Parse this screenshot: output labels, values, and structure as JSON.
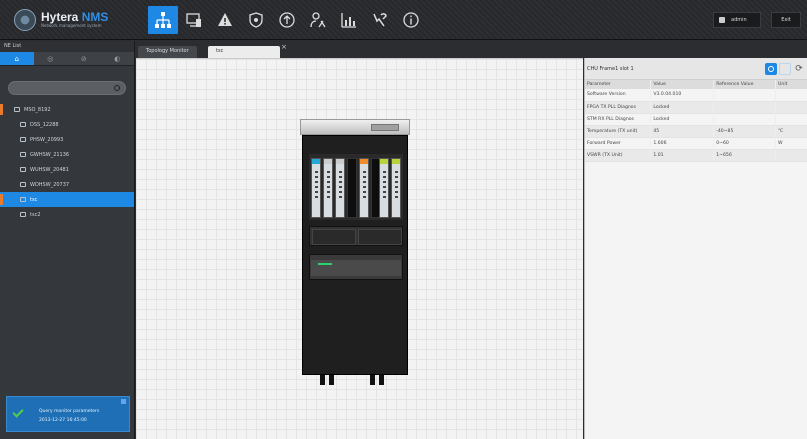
{
  "app": {
    "brand": "Hytera",
    "brand_accent": "NMS",
    "subtitle": "Network management system"
  },
  "nav": {
    "icons": [
      "topology-icon",
      "monitor-icon",
      "alarm-icon",
      "security-icon",
      "upload-icon",
      "user-config-icon",
      "statistics-icon",
      "tools-icon",
      "info-icon"
    ],
    "active": "topology-icon"
  },
  "user": {
    "name": "admin",
    "exit_label": "Exit"
  },
  "left_panel": {
    "title": "NE List",
    "tabs": [
      "⌂",
      "◎",
      "⊘",
      "◐"
    ],
    "search_placeholder": "",
    "tree": [
      {
        "label": "MSO_8192",
        "level": "root"
      },
      {
        "label": "DSS_12288",
        "level": "child"
      },
      {
        "label": "PHSW_20993",
        "level": "child"
      },
      {
        "label": "GWHSW_21136",
        "level": "child"
      },
      {
        "label": "WUHSW_20481",
        "level": "child"
      },
      {
        "label": "WDHSW_20737",
        "level": "child"
      },
      {
        "label": "tsc",
        "level": "child",
        "selected": true
      },
      {
        "label": "tsc2",
        "level": "child"
      }
    ]
  },
  "notification": {
    "title": "Query monitor parameters",
    "time": "2013-12-27 16:45:00"
  },
  "doc_tabs": [
    "Topology Monitor",
    "tsc"
  ],
  "right_panel": {
    "title": "CHU Frame1 slot 1",
    "columns": [
      "Parameter",
      "Value",
      "Reference Value",
      "Unit"
    ],
    "rows": [
      [
        "Software Version",
        "V3.0.04.010",
        "",
        ""
      ],
      [
        "FPGA TX PLL Diagnos",
        "Locked",
        "",
        ""
      ],
      [
        "STM RX PLL Diagnos",
        "Locked",
        "",
        ""
      ],
      [
        "Temperature (TX unit)",
        "45",
        "-40~85",
        "℃"
      ],
      [
        "Forward Power",
        "1.606",
        "0~60",
        "W"
      ],
      [
        "VSWR (TX Unit)",
        "1.01",
        "1~656",
        ""
      ]
    ]
  },
  "colors": {
    "accent": "#1e88e5",
    "topbar": "#2d2f33",
    "panel": "#34373c"
  }
}
